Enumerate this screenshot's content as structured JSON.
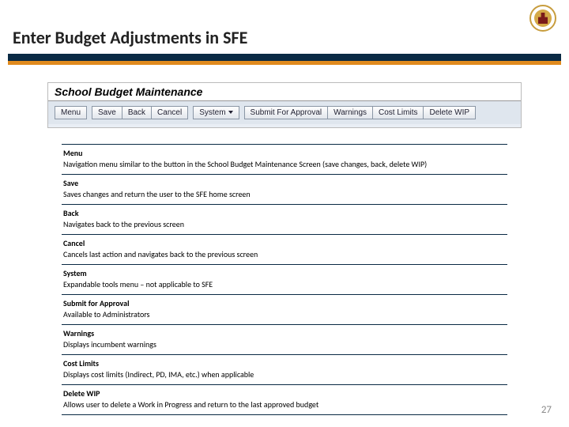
{
  "page": {
    "title": "Enter Budget Adjustments in SFE",
    "number": "27"
  },
  "screenshot": {
    "window_title": "School Budget Maintenance",
    "buttons": {
      "menu": "Menu",
      "save": "Save",
      "back": "Back",
      "cancel": "Cancel",
      "system": "System",
      "submit": "Submit For Approval",
      "warnings": "Warnings",
      "cost_limits": "Cost Limits",
      "delete_wip": "Delete WIP"
    }
  },
  "definitions": [
    {
      "term": "Menu",
      "desc": "Navigation menu similar to the button in the School Budget Maintenance Screen (save changes, back, delete WIP)"
    },
    {
      "term": "Save",
      "desc": "Saves changes and return the user to the SFE home screen"
    },
    {
      "term": "Back",
      "desc": "Navigates back to the previous screen"
    },
    {
      "term": "Cancel",
      "desc": "Cancels last action and navigates back to the previous screen"
    },
    {
      "term": "System",
      "desc": "Expandable tools menu – not applicable to SFE"
    },
    {
      "term": "Submit for Approval",
      "desc": " Available to Administrators"
    },
    {
      "term": "Warnings",
      "desc": "Displays incumbent warnings"
    },
    {
      "term": "Cost Limits",
      "desc": "Displays cost limits (Indirect, PD, IMA, etc.) when applicable"
    },
    {
      "term": "Delete WIP",
      "desc": "Allows user to delete a Work in Progress and return to the last approved budget"
    }
  ]
}
